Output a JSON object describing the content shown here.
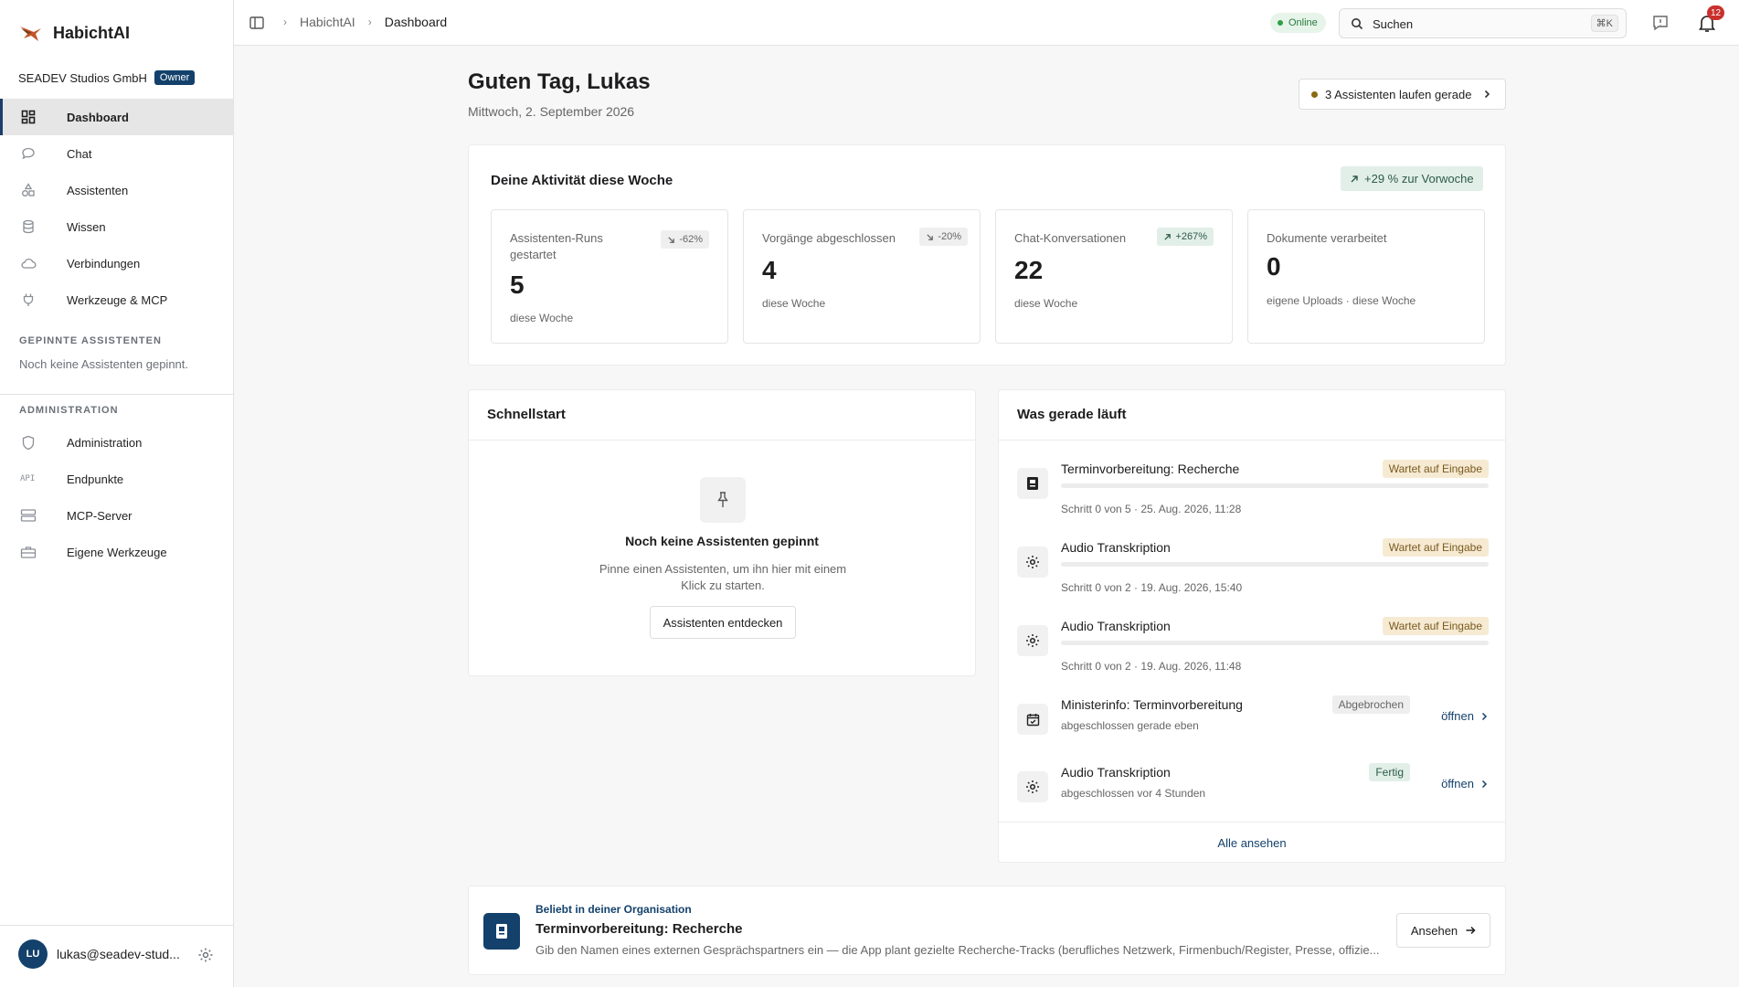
{
  "app": {
    "name": "HabichtAI"
  },
  "org": {
    "name": "SEADEV Studios GmbH",
    "role_badge": "Owner"
  },
  "sidebar": {
    "items": [
      {
        "label": "Dashboard",
        "icon": "dashboard-icon",
        "active": true
      },
      {
        "label": "Chat",
        "icon": "chat-icon"
      },
      {
        "label": "Assistenten",
        "icon": "assistants-icon"
      },
      {
        "label": "Wissen",
        "icon": "database-icon"
      },
      {
        "label": "Verbindungen",
        "icon": "cloud-icon"
      },
      {
        "label": "Werkzeuge & MCP",
        "icon": "plug-icon"
      }
    ],
    "pinned_title": "GEPINNTE ASSISTENTEN",
    "pinned_empty": "Noch keine Assistenten gepinnt.",
    "admin_title": "ADMINISTRATION",
    "admin_items": [
      {
        "label": "Administration",
        "icon": "shield-icon"
      },
      {
        "label": "Endpunkte",
        "icon": "api-icon",
        "icon_text": "API"
      },
      {
        "label": "MCP-Server",
        "icon": "server-icon"
      },
      {
        "label": "Eigene Werkzeuge",
        "icon": "toolbox-icon"
      }
    ],
    "user": {
      "initials": "LU",
      "email": "lukas@seadev-stud..."
    }
  },
  "topbar": {
    "breadcrumb": [
      "HabichtAI",
      "Dashboard"
    ],
    "status": "Online",
    "search": {
      "placeholder": "Suchen",
      "shortcut": "⌘K"
    },
    "notifications": "12"
  },
  "main": {
    "greeting": "Guten Tag, Lukas",
    "date": "Mittwoch, 2. September 2026",
    "running_button": "3 Assistenten laufen gerade",
    "activity": {
      "title": "Deine Aktivität diese Woche",
      "trend": "+29 % zur Vorwoche",
      "stats": [
        {
          "label": "Assistenten-Runs gestartet",
          "delta": "-62%",
          "direction": "down",
          "value": "5",
          "sub": "diese Woche"
        },
        {
          "label": "Vorgänge abgeschlossen",
          "delta": "-20%",
          "direction": "down",
          "value": "4",
          "sub": "diese Woche"
        },
        {
          "label": "Chat-Konversationen",
          "delta": "+267%",
          "direction": "up",
          "value": "22",
          "sub": "diese Woche"
        },
        {
          "label": "Dokumente verarbeitet",
          "delta": "",
          "direction": "",
          "value": "0",
          "sub": "eigene Uploads · diese Woche"
        }
      ]
    },
    "quickstart": {
      "title": "Schnellstart",
      "empty_title": "Noch keine Assistenten gepinnt",
      "empty_text": "Pinne einen Assistenten, um ihn hier mit einem Klick zu starten.",
      "button": "Assistenten entdecken"
    },
    "running": {
      "title": "Was gerade läuft",
      "items": [
        {
          "name": "Terminvorbereitung: Recherche",
          "badge": "Wartet auf Eingabe",
          "status": "wait",
          "meta": "Schritt 0 von 5 · 25. Aug. 2026, 11:28",
          "progress": 0,
          "icon": "document-icon"
        },
        {
          "name": "Audio Transkription",
          "badge": "Wartet auf Eingabe",
          "status": "wait",
          "meta": "Schritt 0 von 2 · 19. Aug. 2026, 15:40",
          "progress": 0,
          "icon": "gear-icon"
        },
        {
          "name": "Audio Transkription",
          "badge": "Wartet auf Eingabe",
          "status": "wait",
          "meta": "Schritt 0 von 2 · 19. Aug. 2026, 11:48",
          "progress": 0,
          "icon": "gear-icon"
        },
        {
          "name": "Ministerinfo: Terminvorbereitung",
          "badge": "Abgebrochen",
          "status": "cancel",
          "meta": "abgeschlossen gerade eben",
          "open": "öffnen",
          "icon": "calendar-icon"
        },
        {
          "name": "Audio Transkription",
          "badge": "Fertig",
          "status": "done",
          "meta": "abgeschlossen vor 4 Stunden",
          "open": "öffnen",
          "icon": "gear-icon"
        }
      ],
      "see_all": "Alle ansehen"
    },
    "popular": {
      "kicker": "Beliebt in deiner Organisation",
      "title": "Terminvorbereitung: Recherche",
      "desc": "Gib den Namen eines externen Gesprächspartners ein — die App plant gezielte Recherche-Tracks (berufliches Netzwerk, Firmenbuch/Register, Presse, offizie...",
      "button": "Ansehen"
    }
  },
  "colors": {
    "accent": "#13416b",
    "online": "#2ea043",
    "badge_wait_bg": "#f6ead3",
    "badge_done_bg": "#e2efe9"
  }
}
